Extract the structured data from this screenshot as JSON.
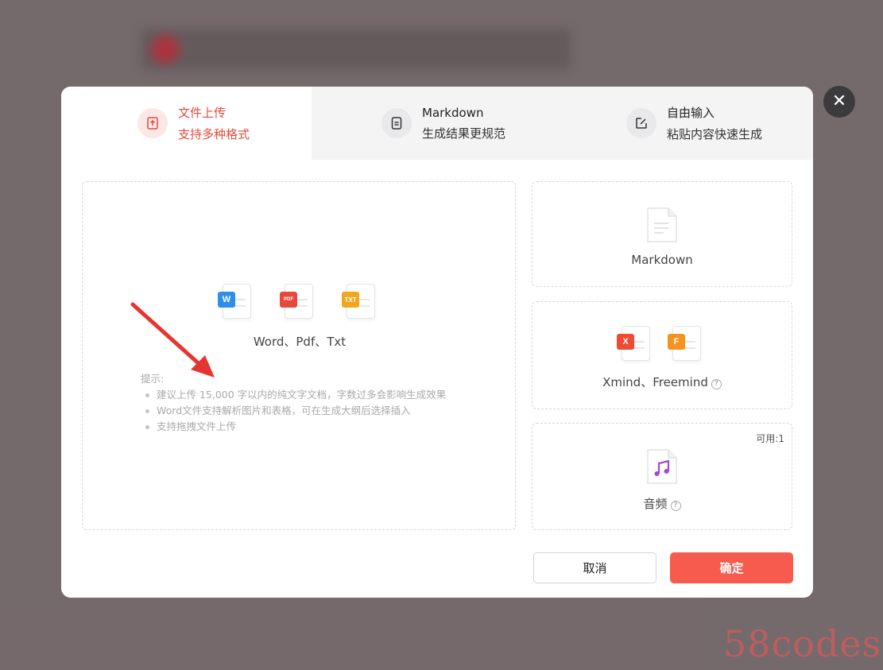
{
  "tabs": [
    {
      "title": "文件上传",
      "subtitle": "支持多种格式",
      "icon": "upload-file-icon",
      "active": true
    },
    {
      "title": "Markdown",
      "subtitle": "生成结果更规范",
      "icon": "document-icon",
      "active": false
    },
    {
      "title": "自由输入",
      "subtitle": "粘贴内容快速生成",
      "icon": "edit-icon",
      "active": false
    }
  ],
  "upload": {
    "file_badges": [
      "W",
      "PDF",
      "TXT"
    ],
    "formats_label": "Word、Pdf、Txt",
    "tips_title": "提示:",
    "tips": [
      "建议上传 15,000 字以内的纯文字文档，字数过多会影响生成效果",
      "Word文件支持解析图片和表格，可在生成大纲后选择插入",
      "支持拖拽文件上传"
    ]
  },
  "cards": {
    "markdown": {
      "label": "Markdown"
    },
    "mindmap": {
      "label": "Xmind、Freemind",
      "badges": [
        "X",
        "F"
      ]
    },
    "audio": {
      "label": "音频",
      "available": "可用:1"
    }
  },
  "buttons": {
    "cancel": "取消",
    "confirm": "确定"
  },
  "close_glyph": "✕",
  "help_glyph": "?",
  "watermark": "58codes",
  "colors": {
    "accent": "#f65b4d",
    "active_text": "#e04b3c",
    "word": "#2f8fe8",
    "pdf": "#e8483b",
    "txt": "#f2a61b",
    "xmind": "#ee4b32",
    "freemind": "#f7921e",
    "audio": "#a347d6"
  }
}
